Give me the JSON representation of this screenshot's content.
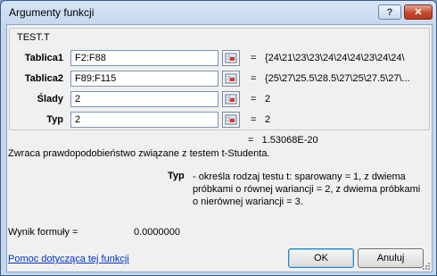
{
  "window": {
    "title": "Argumenty funkcji",
    "help": "?",
    "close": "✕"
  },
  "function": {
    "name": "TEST.T"
  },
  "args": [
    {
      "label": "Tablica1",
      "input": "F2:F88",
      "value": "{24\\21\\23\\23\\24\\24\\24\\23\\24\\24\\"
    },
    {
      "label": "Tablica2",
      "input": "F89:F115",
      "value": "{25\\27\\25.5\\28.5\\27\\25\\27.5\\27\\..."
    },
    {
      "label": "Ślady",
      "input": "2",
      "value": "2"
    },
    {
      "label": "Typ",
      "input": "2",
      "value": "2"
    }
  ],
  "equals": "=",
  "result": "1.53068E-20",
  "description": "Zwraca prawdopodobieństwo związane z testem t-Studenta.",
  "arg_help": {
    "name": "Typ",
    "text": "- określa rodzaj testu t: sparowany = 1, z dwiema próbkami o równej wariancji = 2, z dwiema próbkami o nierównej wariancji = 3."
  },
  "formula_result": {
    "label": "Wynik formuły =",
    "value": "0.0000000"
  },
  "help_link": "Pomoc dotycząca tej funkcji",
  "buttons": {
    "ok": "OK",
    "cancel": "Anuluj"
  },
  "colors": {
    "link": "#0033cc",
    "close_button": "#c44a2f"
  },
  "icons": {
    "collapse": "range-selector-icon"
  }
}
